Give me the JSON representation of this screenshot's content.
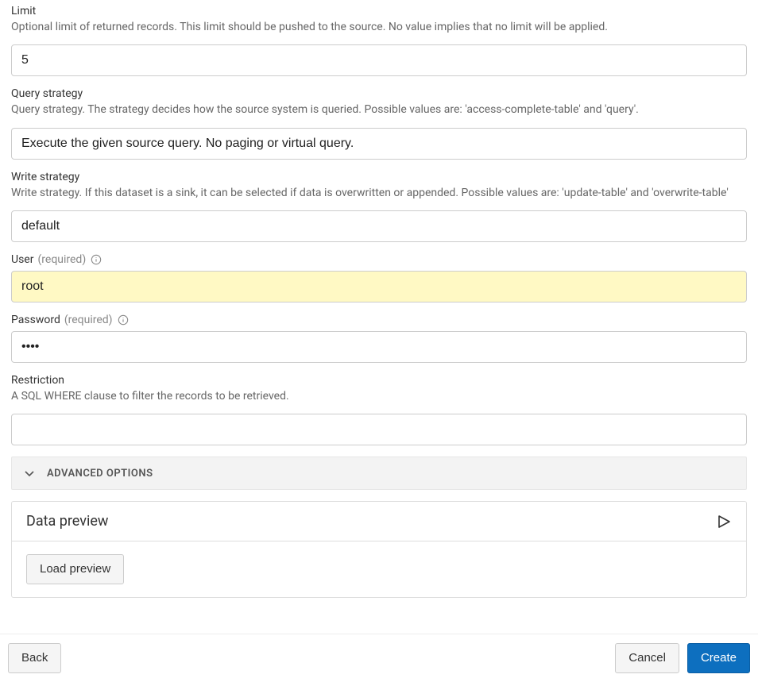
{
  "fields": {
    "limit": {
      "label": "Limit",
      "description": "Optional limit of returned records. This limit should be pushed to the source. No value implies that no limit will be applied.",
      "value": "5"
    },
    "query_strategy": {
      "label": "Query strategy",
      "description": "Query strategy. The strategy decides how the source system is queried. Possible values are: 'access-complete-table' and 'query'.",
      "value": "Execute the given source query. No paging or virtual query."
    },
    "write_strategy": {
      "label": "Write strategy",
      "description": "Write strategy. If this dataset is a sink, it can be selected if data is overwritten or appended. Possible values are: 'update-table' and 'overwrite-table'",
      "value": "default"
    },
    "user": {
      "label": "User",
      "required_hint": "(required)",
      "value": "root"
    },
    "password": {
      "label": "Password",
      "required_hint": "(required)",
      "value": "••••"
    },
    "restriction": {
      "label": "Restriction",
      "description": "A SQL WHERE clause to filter the records to be retrieved.",
      "value": ""
    }
  },
  "accordion": {
    "advanced_options": "ADVANCED OPTIONS"
  },
  "preview": {
    "title": "Data preview",
    "load_button": "Load preview"
  },
  "footer": {
    "back": "Back",
    "cancel": "Cancel",
    "create": "Create"
  }
}
